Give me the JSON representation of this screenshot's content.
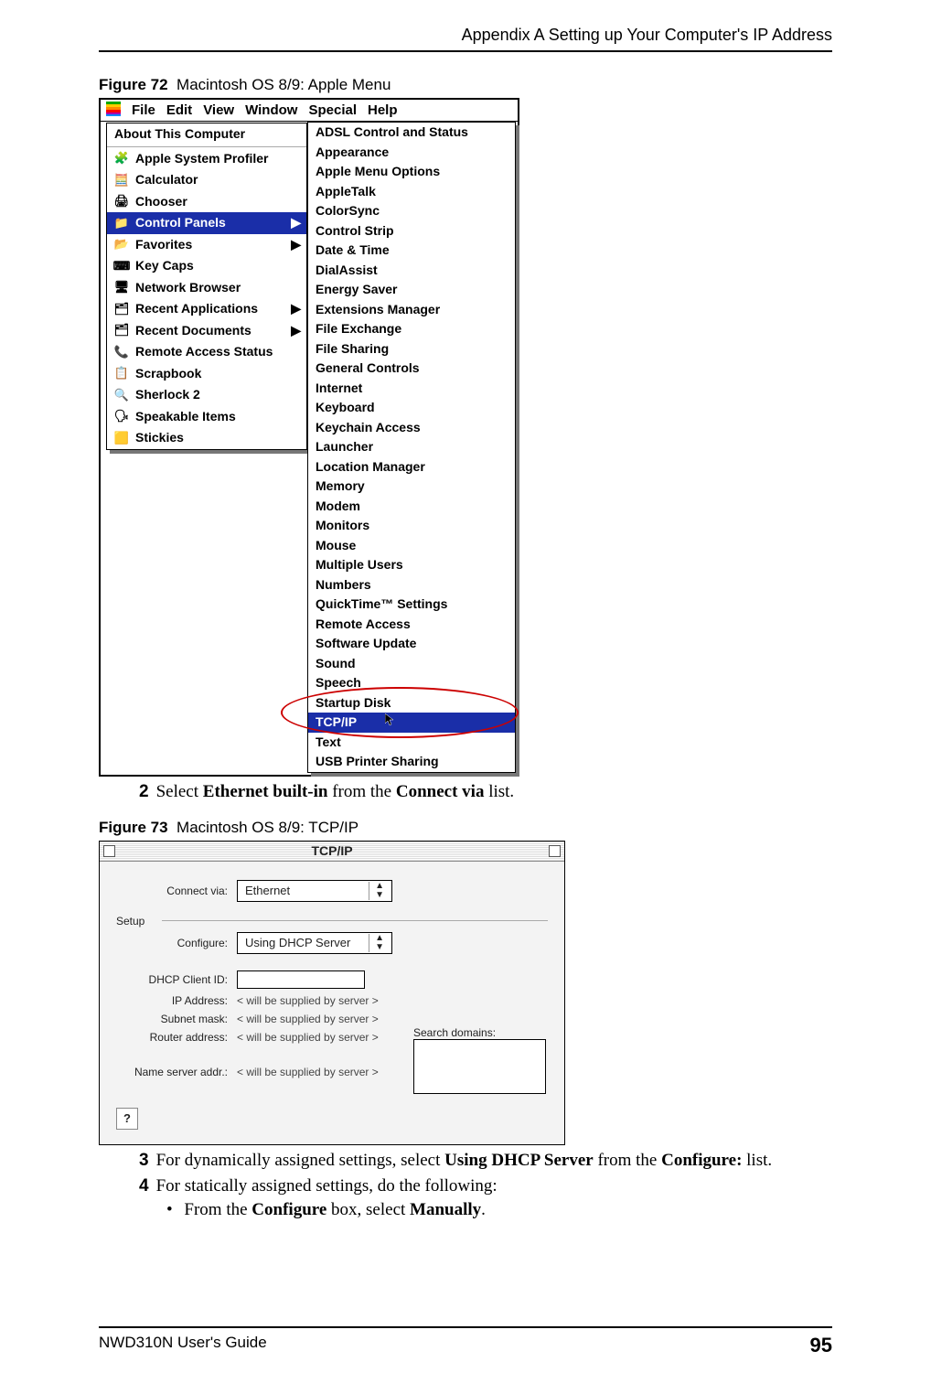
{
  "header": {
    "appendix": "Appendix A Setting up Your Computer's IP Address"
  },
  "fig72": {
    "label": "Figure 72",
    "caption": "Macintosh OS 8/9: Apple Menu",
    "menubar": [
      "File",
      "Edit",
      "View",
      "Window",
      "Special",
      "Help"
    ],
    "apple_menu": {
      "about": "About This Computer",
      "items": [
        {
          "label": "Apple System Profiler",
          "icon": "🧩"
        },
        {
          "label": "Calculator",
          "icon": "🧮"
        },
        {
          "label": "Chooser",
          "icon": "🖨"
        },
        {
          "label": "Control Panels",
          "icon": "📁",
          "selected": true,
          "sub": true
        },
        {
          "label": "Favorites",
          "icon": "📂",
          "sub": true
        },
        {
          "label": "Key Caps",
          "icon": "⌨"
        },
        {
          "label": "Network Browser",
          "icon": "🖥"
        },
        {
          "label": "Recent Applications",
          "icon": "🗂",
          "sub": true
        },
        {
          "label": "Recent Documents",
          "icon": "🗂",
          "sub": true
        },
        {
          "label": "Remote Access Status",
          "icon": "📞"
        },
        {
          "label": "Scrapbook",
          "icon": "📋"
        },
        {
          "label": "Sherlock 2",
          "icon": "🔍"
        },
        {
          "label": "Speakable Items",
          "icon": "🗣"
        },
        {
          "label": "Stickies",
          "icon": "🟨"
        }
      ]
    },
    "control_panels": [
      "ADSL Control and Status",
      "Appearance",
      "Apple Menu Options",
      "AppleTalk",
      "ColorSync",
      "Control Strip",
      "Date & Time",
      "DialAssist",
      "Energy Saver",
      "Extensions Manager",
      "File Exchange",
      "File Sharing",
      "General Controls",
      "Internet",
      "Keyboard",
      "Keychain Access",
      "Launcher",
      "Location Manager",
      "Memory",
      "Modem",
      "Monitors",
      "Mouse",
      "Multiple Users",
      "Numbers",
      "QuickTime™ Settings",
      "Remote Access",
      "Software Update",
      "Sound",
      "Speech",
      "Startup Disk",
      "TCP/IP",
      "Text",
      "USB Printer Sharing"
    ],
    "selected_panel": "TCP/IP"
  },
  "step2": {
    "num": "2",
    "pre": "Select ",
    "bold1": "Ethernet built-in",
    "mid": " from the ",
    "bold2": "Connect via",
    "post": " list."
  },
  "fig73": {
    "label": "Figure 73",
    "caption": "Macintosh OS 8/9: TCP/IP",
    "title": "TCP/IP",
    "connect_via_label": "Connect via:",
    "connect_via_value": "Ethernet",
    "setup_label": "Setup",
    "configure_label": "Configure:",
    "configure_value": "Using DHCP Server",
    "dhcp_client_label": "DHCP Client ID:",
    "ip_label": "IP Address:",
    "subnet_label": "Subnet mask:",
    "router_label": "Router address:",
    "nameserver_label": "Name server addr.:",
    "supplied": "< will be supplied by server >",
    "search_domains_label": "Search domains:",
    "help": "?"
  },
  "step3": {
    "num": "3",
    "pre": "For dynamically assigned settings, select ",
    "bold1": "Using DHCP Server",
    "mid": " from the ",
    "bold2": "Configure:",
    "post": " list."
  },
  "step4": {
    "num": "4",
    "text": "For statically assigned settings, do the following:"
  },
  "bullet1": {
    "pre": "From the ",
    "bold1": "Configure",
    "mid": " box, select ",
    "bold2": "Manually",
    "post": "."
  },
  "footer": {
    "guide": "NWD310N User's Guide",
    "page": "95"
  }
}
